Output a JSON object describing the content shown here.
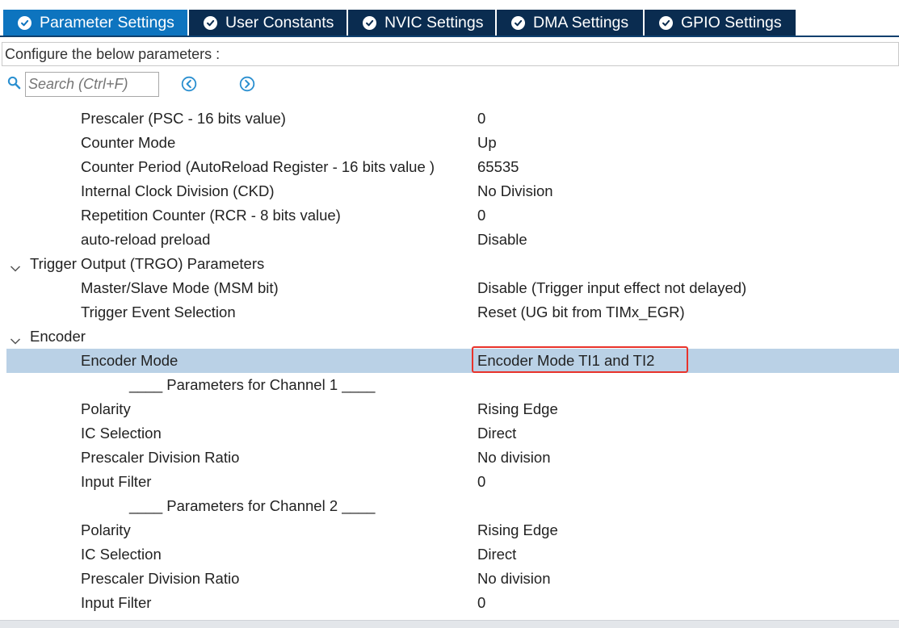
{
  "tabs": [
    {
      "label": "Parameter Settings"
    },
    {
      "label": "User Constants"
    },
    {
      "label": "NVIC Settings"
    },
    {
      "label": "DMA Settings"
    },
    {
      "label": "GPIO Settings"
    }
  ],
  "configure_label": "Configure the below parameters :",
  "search": {
    "placeholder": "Search (Ctrl+F)"
  },
  "rows": [
    {
      "label": "Prescaler (PSC - 16 bits value)",
      "value": "0"
    },
    {
      "label": "Counter Mode",
      "value": "Up"
    },
    {
      "label": "Counter Period (AutoReload Register - 16 bits value )",
      "value": "65535"
    },
    {
      "label": "Internal Clock Division (CKD)",
      "value": "No Division"
    },
    {
      "label": "Repetition Counter (RCR - 8 bits value)",
      "value": "0"
    },
    {
      "label": "auto-reload preload",
      "value": "Disable"
    },
    {
      "label": "Trigger Output (TRGO) Parameters"
    },
    {
      "label": "Master/Slave Mode (MSM bit)",
      "value": "Disable (Trigger input effect not delayed)"
    },
    {
      "label": "Trigger Event Selection",
      "value": "Reset (UG bit from TIMx_EGR)"
    },
    {
      "label": "Encoder"
    },
    {
      "label": "Encoder Mode",
      "value": "Encoder Mode TI1 and TI2"
    },
    {
      "label": "____ Parameters for Channel 1 ____"
    },
    {
      "label": "Polarity",
      "value": "Rising Edge"
    },
    {
      "label": "IC Selection",
      "value": "Direct"
    },
    {
      "label": "Prescaler Division Ratio",
      "value": "No division"
    },
    {
      "label": "Input Filter",
      "value": "0"
    },
    {
      "label": "____ Parameters for Channel 2 ____"
    },
    {
      "label": "Polarity",
      "value": "Rising Edge"
    },
    {
      "label": "IC Selection",
      "value": "Direct"
    },
    {
      "label": "Prescaler Division Ratio",
      "value": "No division"
    },
    {
      "label": "Input Filter",
      "value": "0"
    }
  ],
  "colors": {
    "active_tab": "#0d74bf",
    "inactive_tab": "#0a2c50",
    "selection": "#bad1e6",
    "highlight_box": "#e8332b"
  }
}
